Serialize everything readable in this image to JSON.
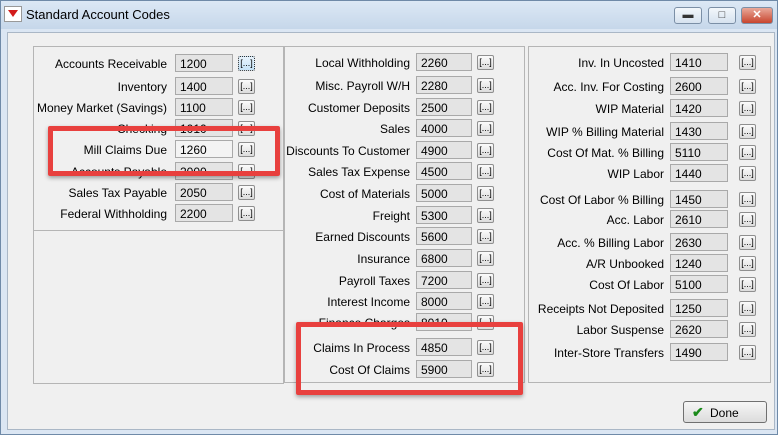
{
  "window": {
    "title": "Standard Account Codes",
    "minimize_glyph": "▬",
    "maximize_glyph": "□",
    "close_glyph": "✕"
  },
  "browse_label": "[...]",
  "left_panel": [
    {
      "label": "Accounts Receivable",
      "code": "1200"
    },
    {
      "label": "Inventory",
      "code": "1400"
    },
    {
      "label": "Money Market (Savings)",
      "code": "1100"
    },
    {
      "label": "Checking",
      "code": "1010"
    },
    {
      "label": "Mill Claims Due",
      "code": "1260"
    },
    {
      "label": "Accounts Payable",
      "code": "2000"
    },
    {
      "label": "Sales Tax Payable",
      "code": "2050"
    },
    {
      "label": "Federal Withholding",
      "code": "2200"
    }
  ],
  "middle_panel": [
    {
      "label": "Local Withholding",
      "code": "2260"
    },
    {
      "label": "Misc. Payroll W/H",
      "code": "2280"
    },
    {
      "label": "Customer Deposits",
      "code": "2500"
    },
    {
      "label": "Sales",
      "code": "4000"
    },
    {
      "label": "Discounts To Customer",
      "code": "4900"
    },
    {
      "label": "Sales Tax Expense",
      "code": "4500"
    },
    {
      "label": "Cost of Materials",
      "code": "5000"
    },
    {
      "label": "Freight",
      "code": "5300"
    },
    {
      "label": "Earned Discounts",
      "code": "5600"
    },
    {
      "label": "Insurance",
      "code": "6800"
    },
    {
      "label": "Payroll Taxes",
      "code": "7200"
    },
    {
      "label": "Interest Income",
      "code": "8000"
    },
    {
      "label": "Finance Charges",
      "code": "8010"
    },
    {
      "label": "Claims In Process",
      "code": "4850"
    },
    {
      "label": "Cost Of Claims",
      "code": "5900"
    }
  ],
  "right_panel": [
    {
      "label": "Inv. In Uncosted",
      "code": "1410"
    },
    {
      "label": "Acc. Inv. For Costing",
      "code": "2600"
    },
    {
      "label": "WIP Material",
      "code": "1420"
    },
    {
      "label": "WIP % Billing Material",
      "code": "1430"
    },
    {
      "label": "Cost Of Mat. % Billing",
      "code": "5110"
    },
    {
      "label": "WIP Labor",
      "code": "1440"
    },
    {
      "label": "Cost Of Labor % Billing",
      "code": "1450"
    },
    {
      "label": "Acc. Labor",
      "code": "2610"
    },
    {
      "label": "Acc. % Billing Labor",
      "code": "2630"
    },
    {
      "label": "A/R Unbooked",
      "code": "1240"
    },
    {
      "label": "Cost Of Labor",
      "code": "5100"
    },
    {
      "label": "Receipts Not Deposited",
      "code": "1250"
    },
    {
      "label": "Labor Suspense",
      "code": "2620"
    },
    {
      "label": "Inter-Store Transfers",
      "code": "1490"
    }
  ],
  "done_button": {
    "label": "Done",
    "icon": "checkmark-icon",
    "glyph": "✔"
  },
  "colors": {
    "highlight_border": "#e8403e"
  }
}
